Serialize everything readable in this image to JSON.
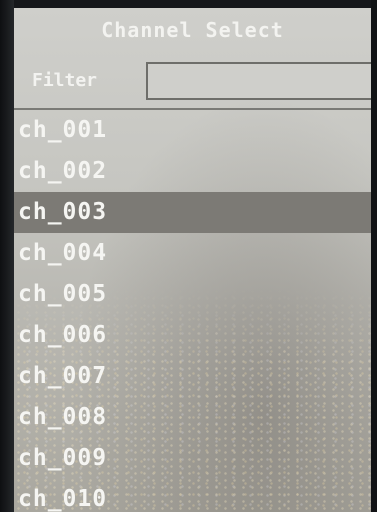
{
  "dialog": {
    "title": "Channel Select"
  },
  "filter": {
    "label": "Filter",
    "value": "",
    "placeholder": ""
  },
  "channels": {
    "items": [
      {
        "label": "ch_001",
        "selected": false
      },
      {
        "label": "ch_002",
        "selected": false
      },
      {
        "label": "ch_003",
        "selected": true
      },
      {
        "label": "ch_004",
        "selected": false
      },
      {
        "label": "ch_005",
        "selected": false
      },
      {
        "label": "ch_006",
        "selected": false
      },
      {
        "label": "ch_007",
        "selected": false
      },
      {
        "label": "ch_008",
        "selected": false
      },
      {
        "label": "ch_009",
        "selected": false
      },
      {
        "label": "ch_010",
        "selected": false
      }
    ]
  },
  "colors": {
    "panel": "#c9c9c5",
    "selection": "#7c7a75",
    "text": "#f5f5f2"
  }
}
